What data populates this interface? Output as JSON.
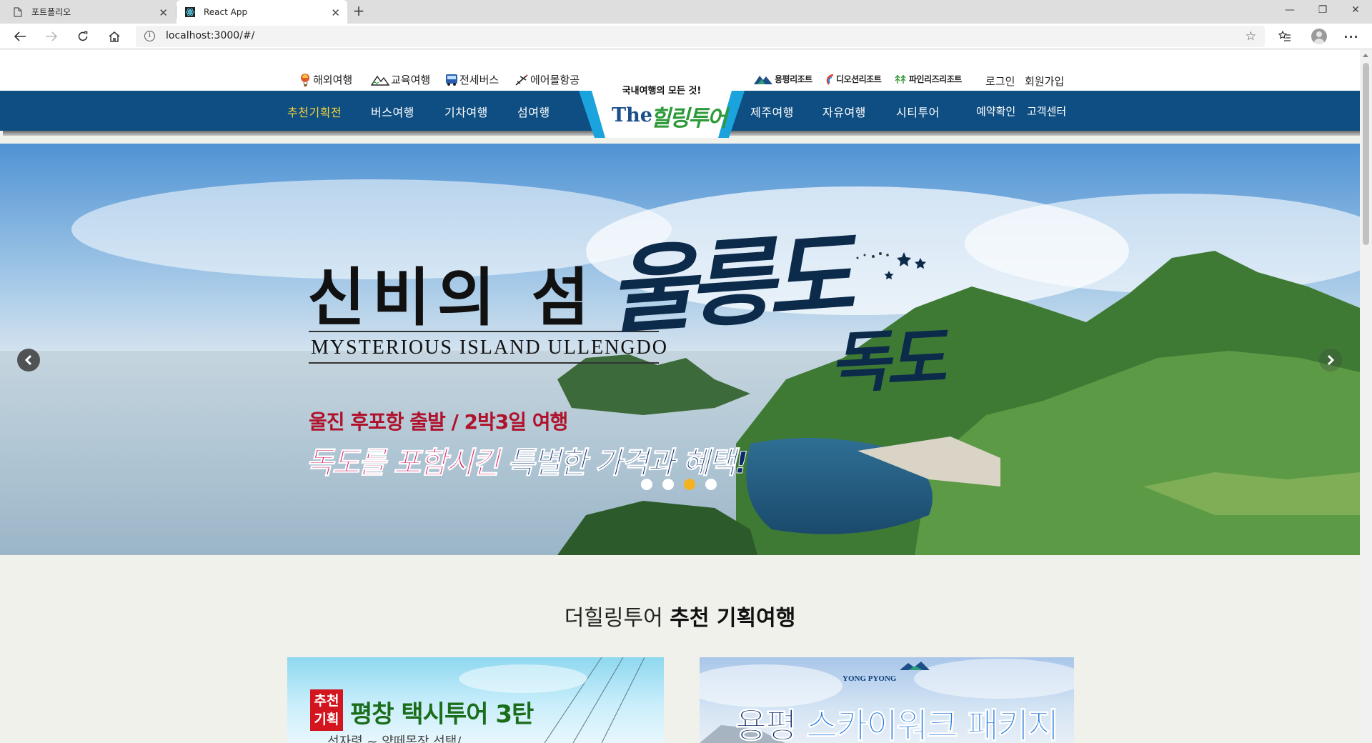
{
  "browser": {
    "tabs": [
      {
        "title": "포트폴리오"
      },
      {
        "title": "React App"
      }
    ],
    "url": "localhost:3000/#/"
  },
  "site": {
    "util_links": [
      {
        "label": "해외여행",
        "icon": "balloon-icon"
      },
      {
        "label": "교육여행",
        "icon": "mountain-icon"
      },
      {
        "label": "전세버스",
        "icon": "bus-icon"
      },
      {
        "label": "에어몰항공",
        "icon": "airplane-icon"
      }
    ],
    "resorts": [
      {
        "label": "용평리조트",
        "icon": "yongpyong-logo-icon"
      },
      {
        "label": "디오션리조트",
        "icon": "theocean-logo-icon"
      },
      {
        "label": "파인리즈리조트",
        "icon": "pinerise-logo-icon"
      }
    ],
    "auth": {
      "login": "로그인",
      "signup": "회원가입"
    },
    "nav_left": [
      "추천기획전",
      "버스여행",
      "기차여행",
      "섬여행"
    ],
    "nav_right": [
      "제주여행",
      "자유여행",
      "시티투어"
    ],
    "nav_small": [
      "예약확인",
      "고객센터"
    ],
    "logo": {
      "tagline": "국내여행의 모든 것!",
      "name_en": "The",
      "name_ko": "힐링투어"
    },
    "colors": {
      "nav_bg": "#0f4e82",
      "nav_active": "#f7d53a",
      "dot_active": "#f3b321"
    }
  },
  "hero": {
    "title_ko": "신비의 섬",
    "title_en": "MYSTERIOUS ISLAND ULLENGDO",
    "brush_1": "울릉도",
    "brush_2": "독도",
    "sub_1": "울진 후포항 출발 / 2박3일 여행",
    "sub_2a": "독도를 포함시킨",
    "sub_2b": "특별한 가격과 혜택!",
    "slides_total": 4,
    "slide_active": 3
  },
  "section": {
    "title_light": "더힐링투어",
    "title_bold": "추천 기획여행",
    "cards": [
      {
        "stamp": "추천\n기획",
        "title": "평창 택시투어 3탄",
        "sub": "선자령 ~ 양떼목장 선택/"
      },
      {
        "brand": "YONG PYONG",
        "title_a": "용평",
        "title_b": "스카이워크 패키지"
      }
    ]
  }
}
